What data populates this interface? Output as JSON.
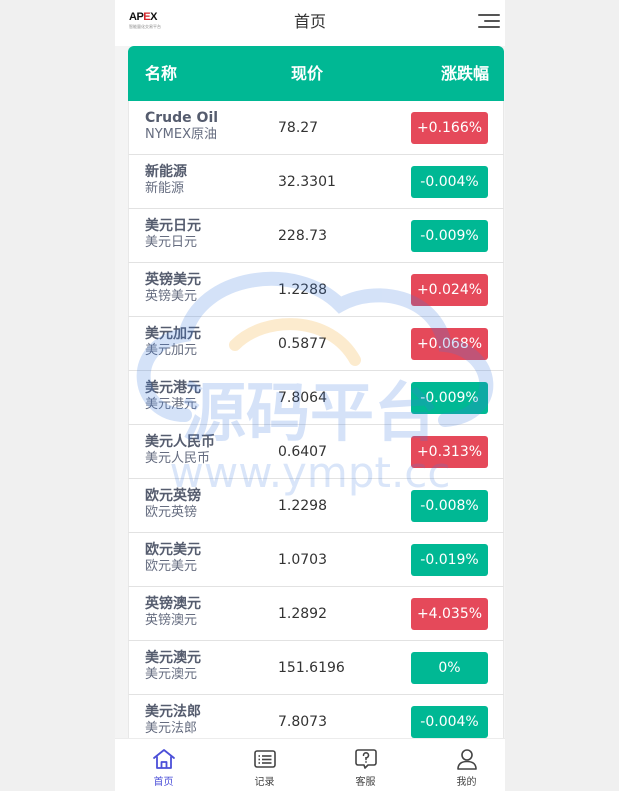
{
  "header": {
    "logo_text": "APEX",
    "logo_subtext": "智能量化交易平台",
    "title": "首页"
  },
  "table": {
    "columns": [
      "名称",
      "现价",
      "涨跌幅"
    ],
    "rows": [
      {
        "name": "Crude Oil",
        "sub": "NYMEX原油",
        "price": "78.27",
        "change": "+0.166%",
        "dir": "up"
      },
      {
        "name": "新能源",
        "sub": "新能源",
        "price": "32.3301",
        "change": "-0.004%",
        "dir": "down"
      },
      {
        "name": "美元日元",
        "sub": "美元日元",
        "price": "228.73",
        "change": "-0.009%",
        "dir": "down"
      },
      {
        "name": "英镑美元",
        "sub": "英镑美元",
        "price": "1.2288",
        "change": "+0.024%",
        "dir": "up"
      },
      {
        "name": "美元加元",
        "sub": "美元加元",
        "price": "0.5877",
        "change": "+0.068%",
        "dir": "up"
      },
      {
        "name": "美元港元",
        "sub": "美元港元",
        "price": "7.8064",
        "change": "-0.009%",
        "dir": "down"
      },
      {
        "name": "美元人民币",
        "sub": "美元人民币",
        "price": "0.6407",
        "change": "+0.313%",
        "dir": "up"
      },
      {
        "name": "欧元英镑",
        "sub": "欧元英镑",
        "price": "1.2298",
        "change": "-0.008%",
        "dir": "down"
      },
      {
        "name": "欧元美元",
        "sub": "欧元美元",
        "price": "1.0703",
        "change": "-0.019%",
        "dir": "down"
      },
      {
        "name": "英镑澳元",
        "sub": "英镑澳元",
        "price": "1.2892",
        "change": "+4.035%",
        "dir": "up"
      },
      {
        "name": "美元澳元",
        "sub": "美元澳元",
        "price": "151.6196",
        "change": "0%",
        "dir": "down"
      },
      {
        "name": "美元法郎",
        "sub": "美元法郎",
        "price": "7.8073",
        "change": "-0.004%",
        "dir": "down"
      }
    ]
  },
  "watermark": {
    "title": "源码平台",
    "url": "www.ympt.cc"
  },
  "tabbar": {
    "items": [
      {
        "label": "首页",
        "icon": "home-icon",
        "active": true
      },
      {
        "label": "记录",
        "icon": "list-icon",
        "active": false
      },
      {
        "label": "客服",
        "icon": "help-icon",
        "active": false
      },
      {
        "label": "我的",
        "icon": "user-icon",
        "active": false
      }
    ]
  },
  "colors": {
    "primary": "#00b894",
    "up": "#e5495a",
    "down": "#00b894",
    "active_tab": "#4b4fd8"
  }
}
